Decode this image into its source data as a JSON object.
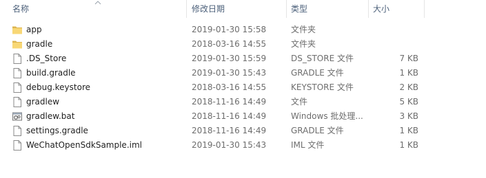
{
  "columns": {
    "name": "名称",
    "date": "修改日期",
    "type": "类型",
    "size": "大小"
  },
  "files": [
    {
      "name": "app",
      "date": "2019-01-30 15:58",
      "type": "文件夹",
      "size": "",
      "icon": "folder-icon"
    },
    {
      "name": "gradle",
      "date": "2018-03-16 14:55",
      "type": "文件夹",
      "size": "",
      "icon": "folder-icon"
    },
    {
      "name": ".DS_Store",
      "date": "2019-01-30 15:59",
      "type": "DS_STORE 文件",
      "size": "7 KB",
      "icon": "file-icon"
    },
    {
      "name": "build.gradle",
      "date": "2019-01-30 15:43",
      "type": "GRADLE 文件",
      "size": "1 KB",
      "icon": "file-icon"
    },
    {
      "name": "debug.keystore",
      "date": "2018-03-16 14:55",
      "type": "KEYSTORE 文件",
      "size": "2 KB",
      "icon": "file-icon"
    },
    {
      "name": "gradlew",
      "date": "2018-11-16 14:49",
      "type": "文件",
      "size": "5 KB",
      "icon": "file-icon"
    },
    {
      "name": "gradlew.bat",
      "date": "2018-11-16 14:49",
      "type": "Windows 批处理...",
      "size": "3 KB",
      "icon": "batch-file-icon"
    },
    {
      "name": "settings.gradle",
      "date": "2018-11-16 14:49",
      "type": "GRADLE 文件",
      "size": "1 KB",
      "icon": "file-icon"
    },
    {
      "name": "WeChatOpenSdkSample.iml",
      "date": "2019-01-30 15:43",
      "type": "IML 文件",
      "size": "1 KB",
      "icon": "file-icon"
    }
  ]
}
